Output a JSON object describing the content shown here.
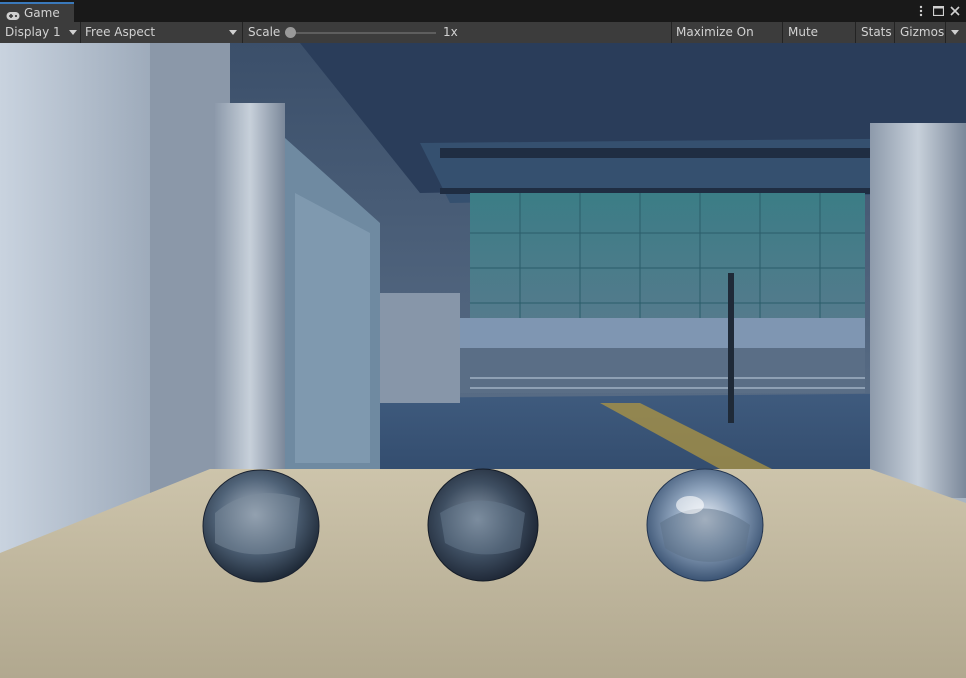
{
  "tab": {
    "label": "Game",
    "icon": "gamepad-icon"
  },
  "window_controls": {
    "menu_icon": "more-vert-icon",
    "maximize_icon": "maximize-icon",
    "close_icon": "close-icon"
  },
  "toolbar": {
    "display": "Display 1",
    "aspect": "Free Aspect",
    "scale_label": "Scale",
    "scale_value": "1x",
    "scale_fraction": 0.0,
    "maximize_on_play": "Maximize On Play",
    "mute_audio": "Mute Audio",
    "stats": "Stats",
    "gizmos": "Gizmos"
  },
  "scene": {
    "spheres": [
      "sphere-reflective-left",
      "sphere-reflective-middle",
      "sphere-reflective-right"
    ],
    "floor_color": "#bdb49b",
    "accent": "#3a79bb"
  }
}
